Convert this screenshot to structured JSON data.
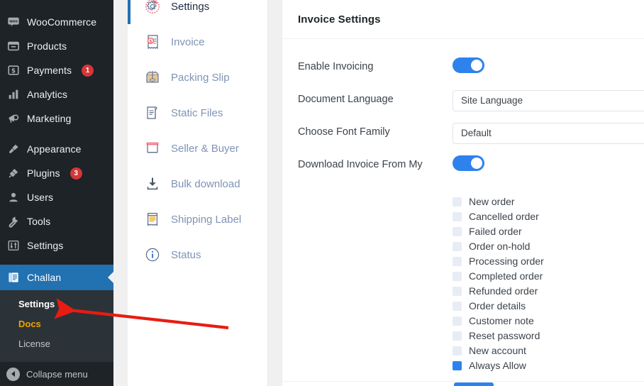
{
  "wp_sidebar": {
    "items": [
      {
        "label": "WooCommerce",
        "icon": "woocommerce-icon",
        "badge": null
      },
      {
        "label": "Products",
        "icon": "products-icon",
        "badge": null
      },
      {
        "label": "Payments",
        "icon": "payments-icon",
        "badge": "1"
      },
      {
        "label": "Analytics",
        "icon": "analytics-icon",
        "badge": null
      },
      {
        "label": "Marketing",
        "icon": "marketing-icon",
        "badge": null
      },
      {
        "label": "Appearance",
        "icon": "appearance-icon",
        "badge": null
      },
      {
        "label": "Plugins",
        "icon": "plugins-icon",
        "badge": "3"
      },
      {
        "label": "Users",
        "icon": "users-icon",
        "badge": null
      },
      {
        "label": "Tools",
        "icon": "tools-icon",
        "badge": null
      },
      {
        "label": "Settings",
        "icon": "settings-sliders-icon",
        "badge": null
      }
    ],
    "current_item": {
      "label": "Challan",
      "icon": "challan-icon"
    },
    "submenu": [
      {
        "label": "Settings",
        "state": "active"
      },
      {
        "label": "Docs",
        "state": "docs"
      },
      {
        "label": "License",
        "state": "normal"
      }
    ],
    "collapse": {
      "label": "Collapse menu",
      "icon": "collapse-arrow-icon"
    },
    "colors": {
      "background": "#1d2327",
      "submenu_background": "#2c3338",
      "current": "#2271b1",
      "badge": "#d63638",
      "docs": "#f0a202"
    }
  },
  "tabs": [
    {
      "label": "Settings",
      "icon": "gear-icon",
      "active": true
    },
    {
      "label": "Invoice",
      "icon": "invoice-icon",
      "active": false
    },
    {
      "label": "Packing Slip",
      "icon": "packing-slip-icon",
      "active": false
    },
    {
      "label": "Static Files",
      "icon": "static-files-icon",
      "active": false
    },
    {
      "label": "Seller & Buyer",
      "icon": "seller-buyer-icon",
      "active": false
    },
    {
      "label": "Bulk download",
      "icon": "bulk-download-icon",
      "active": false
    },
    {
      "label": "Shipping Label",
      "icon": "shipping-label-icon",
      "active": false
    },
    {
      "label": "Status",
      "icon": "status-info-icon",
      "active": false
    }
  ],
  "main": {
    "title": "Invoice Settings",
    "fields": [
      {
        "label": "Enable Invoicing",
        "type": "toggle",
        "value": "on"
      },
      {
        "label": "Document Language",
        "type": "text",
        "value": "Site Language"
      },
      {
        "label": "Choose Font Family",
        "type": "text",
        "value": "Default"
      },
      {
        "label": "Download Invoice From My",
        "type": "toggle",
        "value": "on"
      }
    ],
    "checkboxes": [
      {
        "label": "New order",
        "checked": false
      },
      {
        "label": "Cancelled order",
        "checked": false
      },
      {
        "label": "Failed order",
        "checked": false
      },
      {
        "label": "Order on-hold",
        "checked": false
      },
      {
        "label": "Processing order",
        "checked": false
      },
      {
        "label": "Completed order",
        "checked": false
      },
      {
        "label": "Refunded order",
        "checked": false
      },
      {
        "label": "Order details",
        "checked": false
      },
      {
        "label": "Customer note",
        "checked": false
      },
      {
        "label": "Reset password",
        "checked": false
      },
      {
        "label": "New account",
        "checked": false
      },
      {
        "label": "Always Allow",
        "checked": true
      }
    ],
    "accent_color": "#2e82ee"
  },
  "annotation": {
    "type": "arrow",
    "color": "#e81c12",
    "points_to": "Settings"
  }
}
